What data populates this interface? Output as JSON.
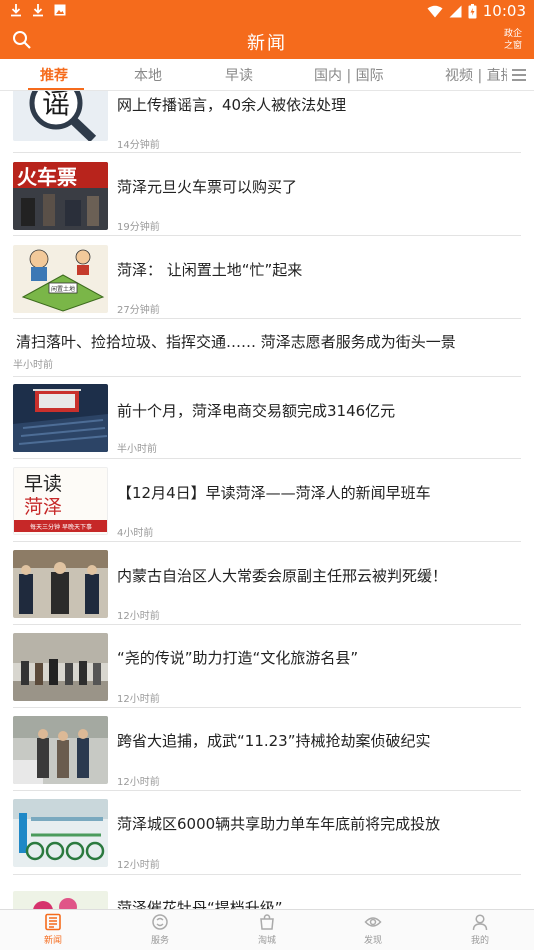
{
  "status": {
    "time": "10:03"
  },
  "header": {
    "title": "新闻",
    "gov_badge": "政企之窗"
  },
  "tabs": [
    {
      "label": "推荐",
      "active": true
    },
    {
      "label": "本地"
    },
    {
      "label": "早读"
    },
    {
      "label": "国内 | 国际"
    },
    {
      "label": "视频 | 直播"
    }
  ],
  "news": [
    {
      "title": "网上传播谣言，40余人被依法处理",
      "time": "14分钟前"
    },
    {
      "title": "菏泽元旦火车票可以购买了",
      "time": "19分钟前"
    },
    {
      "title": "菏泽： 让闲置土地“忙”起来",
      "time": "27分钟前"
    },
    {
      "title": "清扫落叶、捡拾垃圾、指挥交通…… 菏泽志愿者服务成为街头一景",
      "time": "半小时前"
    },
    {
      "title": "前十个月，菏泽电商交易额完成3146亿元",
      "time": "半小时前"
    },
    {
      "title": "【12月4日】早读菏泽——菏泽人的新闻早班车",
      "time": "4小时前"
    },
    {
      "title": "内蒙古自治区人大常委会原副主任邢云被判死缓！",
      "time": "12小时前"
    },
    {
      "title": "“尧的传说”助力打造“文化旅游名县”",
      "time": "12小时前"
    },
    {
      "title": "跨省大追捕，成武“11.23”持械抢劫案侦破纪实",
      "time": "12小时前"
    },
    {
      "title": "菏泽城区6000辆共享助力单车年底前将完成投放",
      "time": "12小时前"
    },
    {
      "title": "菏泽催花牡丹“提档升级”",
      "time": ""
    }
  ],
  "thumb_text": {
    "rumor": "谣",
    "train": "火车票",
    "land": "闲置土地",
    "zaodu_1": "早读",
    "zaodu_2": "菏泽",
    "zaodu_3": "每天三分钟 早晚天下事"
  },
  "bottom_nav": [
    {
      "label": "新闻",
      "icon": "news-icon",
      "active": true
    },
    {
      "label": "服务",
      "icon": "service-icon"
    },
    {
      "label": "淘城",
      "icon": "shopping-bag-icon"
    },
    {
      "label": "发现",
      "icon": "discover-eye-icon"
    },
    {
      "label": "我的",
      "icon": "user-icon"
    }
  ],
  "colors": {
    "accent": "#f56b1c",
    "divider": "#e3e3e3",
    "meta_text": "#999999"
  }
}
